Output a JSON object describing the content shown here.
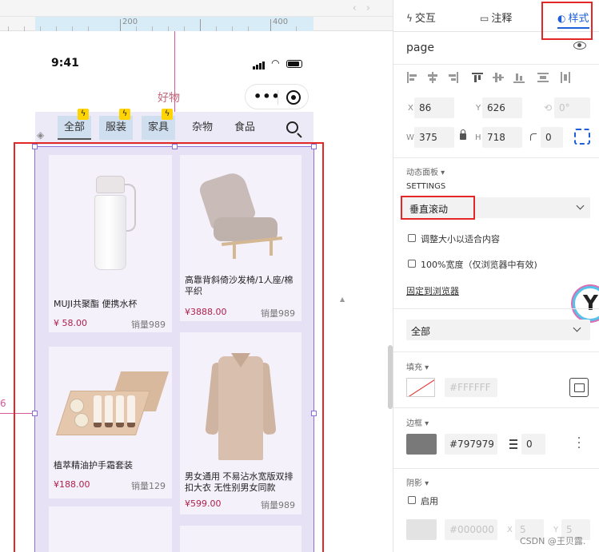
{
  "ruler": {
    "mark_200": "200",
    "mark_400": "400"
  },
  "canvas": {
    "y_readout": "6",
    "status_time": "9:41",
    "page_name": "好物",
    "tabs": [
      {
        "label": "全部",
        "active": true,
        "bolt": true
      },
      {
        "label": "服装",
        "active": false,
        "bolt": true
      },
      {
        "label": "家具",
        "active": false,
        "bolt": true
      },
      {
        "label": "杂物",
        "active": false,
        "bolt": false
      },
      {
        "label": "食品",
        "active": false,
        "bolt": false
      }
    ],
    "products": [
      {
        "name": "MUJI共聚酯 便携水杯",
        "price": "¥ 58.00",
        "sales": "销量989",
        "image": "water-bottle"
      },
      {
        "name": "高靠背斜倚沙发椅/1人座/棉平织",
        "price": "¥3888.00",
        "sales": "销量989",
        "image": "lounge-chair"
      },
      {
        "name": "植萃精油护手霜套装",
        "price": "¥188.00",
        "sales": "销量129",
        "image": "hand-cream-set"
      },
      {
        "name": "男女通用 不易沾水宽版双排扣大衣 无性别男女同款",
        "price": "¥599.00",
        "sales": "销量989",
        "image": "trench-coat"
      }
    ]
  },
  "panel": {
    "tabs": {
      "interaction": "交互",
      "notes": "注释",
      "style": "样式"
    },
    "title": "page",
    "position": {
      "x_label": "X",
      "x_value": "86",
      "y_label": "Y",
      "y_value": "626",
      "rotation_value": "0°"
    },
    "size": {
      "w_label": "W",
      "w_value": "375",
      "h_label": "H",
      "h_value": "718",
      "radius_value": "0"
    },
    "dynamic_panel_label": "动态面板 ▾",
    "settings_label": "SETTINGS",
    "scroll_mode": "垂直滚动",
    "options": [
      {
        "label": "调整大小以适合内容",
        "checked": false
      },
      {
        "label": "100%宽度（仅浏览器中有效)",
        "checked": false
      }
    ],
    "pin_link": "固定到浏览器",
    "scope_select": "全部",
    "fill_section": "填充 ▾",
    "fill_value": "#FFFFFF",
    "border_section": "边框 ▾",
    "border_color": "#797979",
    "border_width": "0",
    "shadow_section": "阴影 ▾",
    "shadow_enable": "启用",
    "shadow_color": "#000000",
    "shadow_x_label": "X",
    "shadow_x_value": "5",
    "shadow_y_label": "Y",
    "shadow_y_value": "5"
  },
  "watermark": "CSDN @王贝露.",
  "colors": {
    "accent": "#1e5fd8",
    "highlight_red": "#e32626",
    "guide_pink": "#d9579b",
    "price": "#b0204a"
  }
}
